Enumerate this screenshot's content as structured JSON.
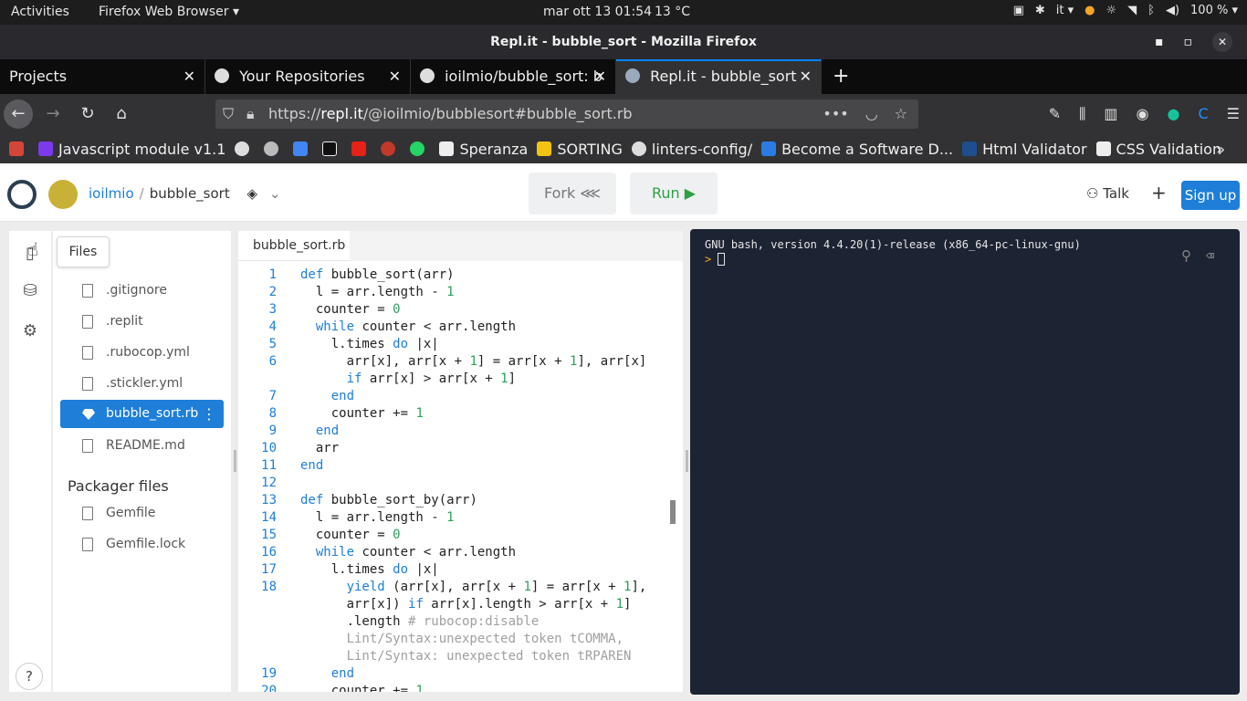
{
  "topbar": {
    "activities": "Activities",
    "app_menu": "Firefox Web Browser ▾",
    "clock": "mar ott 13  01:54",
    "weather": "13 °C",
    "lang": "it ▾",
    "battery": "100 % ▾"
  },
  "window": {
    "title": "Repl.it - bubble_sort - Mozilla Firefox"
  },
  "tabs": [
    {
      "label": "Projects"
    },
    {
      "label": "Your Repositories"
    },
    {
      "label": "ioilmio/bubble_sort: b"
    },
    {
      "label": "Repl.it - bubble_sort"
    }
  ],
  "url": {
    "prefix": "https://",
    "host": "repl.it",
    "path": "/@ioilmio/bubblesort#bubble_sort.rb"
  },
  "bookmarks": [
    "Javascript module v1.1",
    "Speranza",
    "SORTING",
    "linters-config/",
    "Become a Software D...",
    "Html Validator",
    "CSS Validation"
  ],
  "repl": {
    "user": "ioilmio",
    "sep": "/",
    "project": "bubble_sort",
    "fork_label": "Fork",
    "run_label": "Run ▶",
    "talk_label": "Talk",
    "plus_label": "+",
    "signup_label": "Sign up"
  },
  "sidebar": {
    "tooltip": "Files",
    "help": "?"
  },
  "files": {
    "items": [
      ".gitignore",
      ".replit",
      ".rubocop.yml",
      ".stickler.yml",
      "bubble_sort.rb",
      "README.md"
    ],
    "packager_title": "Packager files",
    "packager_items": [
      "Gemfile",
      "Gemfile.lock"
    ]
  },
  "editor": {
    "tab": "bubble_sort.rb",
    "line_numbers": [
      "1",
      "2",
      "3",
      "4",
      "5",
      "6",
      "7",
      "8",
      "9",
      "10",
      "11",
      "12",
      "13",
      "14",
      "15",
      "16",
      "17",
      "18",
      "19",
      "20"
    ]
  },
  "terminal": {
    "banner": "GNU bash, version 4.4.20(1)-release (x86_64-pc-linux-gnu)",
    "prompt": ">"
  },
  "colors": {
    "accent": "#1e7ed8",
    "run_green": "#2ea043",
    "terminal_bg": "#1c2333"
  }
}
